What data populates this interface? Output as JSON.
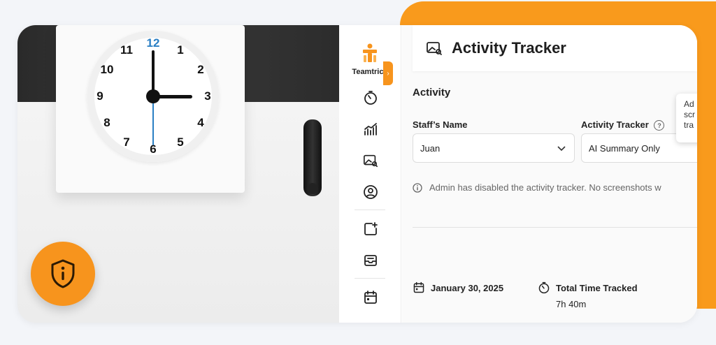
{
  "brand": {
    "name": "Teamtrics",
    "accent": "#f7941d"
  },
  "header": {
    "title": "Activity Tracker",
    "icon": "image-search-icon"
  },
  "activity": {
    "section_title": "Activity",
    "staff_label": "Staff’s Name",
    "staff_value": "Juan",
    "tracker_label": "Activity Tracker",
    "tracker_value": "AI Summary Only",
    "tooltip_lines": [
      "Ad",
      "scr",
      "tra"
    ],
    "notice": "Admin has disabled the activity tracker. No screenshots w"
  },
  "summary": {
    "date": "January 30, 2025",
    "total_label": "Total Time Tracked",
    "total_value": "7h 40m"
  },
  "clock": {
    "numbers": [
      "12",
      "1",
      "2",
      "3",
      "4",
      "5",
      "6",
      "7",
      "8",
      "9",
      "10",
      "11"
    ]
  },
  "sidebar": {
    "icons": [
      "timer-icon",
      "bar-chart-icon",
      "image-search-icon",
      "user-circle-icon",
      "add-note-icon",
      "inbox-icon",
      "calendar-icon"
    ]
  },
  "toggle": {
    "glyph": "›"
  }
}
